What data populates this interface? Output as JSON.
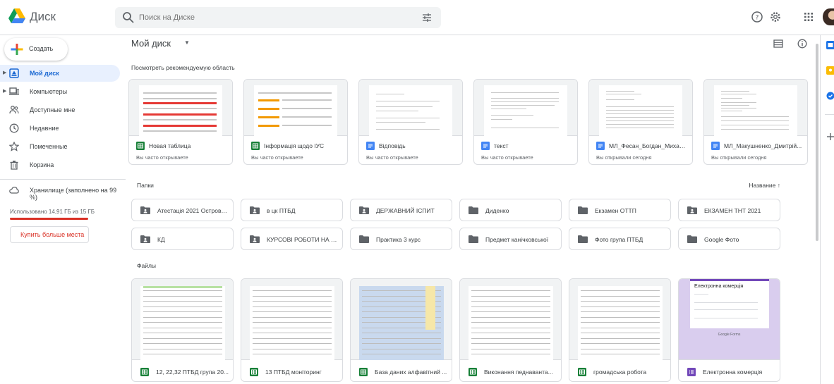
{
  "app": {
    "title": "Диск"
  },
  "search": {
    "placeholder": "Поиск на Диске"
  },
  "sidebar": {
    "create_label": "Создать",
    "items": [
      {
        "label": "Мой диск",
        "icon": "my-drive-icon",
        "active": true,
        "expandable": true
      },
      {
        "label": "Компьютеры",
        "icon": "computer-icon",
        "active": false,
        "expandable": true
      },
      {
        "label": "Доступные мне",
        "icon": "shared-people-icon",
        "active": false,
        "expandable": false
      },
      {
        "label": "Недавние",
        "icon": "clock-icon",
        "active": false,
        "expandable": false
      },
      {
        "label": "Помеченные",
        "icon": "star-icon",
        "active": false,
        "expandable": false
      },
      {
        "label": "Корзина",
        "icon": "trash-icon",
        "active": false,
        "expandable": false
      }
    ],
    "storage_label": "Хранилище (заполнено на 99 %)",
    "storage_used": "Использовано 14,91 ГБ из 15 ГБ",
    "storage_fraction": 0.99,
    "buy_label": "Купить больше места"
  },
  "main": {
    "breadcrumb": "Мой диск",
    "suggested_title": "Посмотреть рекомендуемую область",
    "quick_access": [
      {
        "name": "Новая таблица",
        "sub": "Вы часто открываете",
        "type": "sheet"
      },
      {
        "name": "Інформація щодо ІУС",
        "sub": "Вы часто открываете",
        "type": "sheet"
      },
      {
        "name": "Відповідь",
        "sub": "Вы часто открываете",
        "type": "doc"
      },
      {
        "name": "текст",
        "sub": "Вы часто открываете",
        "type": "doc"
      },
      {
        "name": "МЛ_Фесан_Богдан_Михайл...",
        "sub": "Вы открывали сегодня",
        "type": "doc"
      },
      {
        "name": "МЛ_Макушненко_Дмитрій...",
        "sub": "Вы открывали сегодня",
        "type": "doc"
      }
    ],
    "folders_title": "Папки",
    "sort_label": "Название",
    "folders": [
      {
        "name": "Атестація 2021 Острове...",
        "shared": true
      },
      {
        "name": "в цк ПТБД",
        "shared": true
      },
      {
        "name": "ДЕРЖАВНИЙ ІСПИТ",
        "shared": true
      },
      {
        "name": "Диденко",
        "shared": false
      },
      {
        "name": "Екзамен ОТТП",
        "shared": false
      },
      {
        "name": "ЕКЗАМЕН ТНТ 2021",
        "shared": true
      },
      {
        "name": "КД",
        "shared": true
      },
      {
        "name": "КУРСОВІ РОБОТИ НА М...",
        "shared": true
      },
      {
        "name": "Практика 3 курс",
        "shared": false
      },
      {
        "name": "Предмет канічковської",
        "shared": false
      },
      {
        "name": "Фото група ПТБД",
        "shared": false
      },
      {
        "name": "Google Фото",
        "shared": false
      }
    ],
    "files_title": "Файлы",
    "files": [
      {
        "name": "12, 22,32 ПТБД група 20...",
        "type": "sheet"
      },
      {
        "name": "13 ПТБД моніторинг",
        "type": "sheet"
      },
      {
        "name": "База даних алфавітний ...",
        "type": "sheet"
      },
      {
        "name": "Виконання педнаванта...",
        "type": "sheet"
      },
      {
        "name": "громадська робота",
        "type": "sheet"
      },
      {
        "name": "Електронна комерція",
        "type": "form"
      }
    ],
    "form_preview": {
      "title": "Електронна комерція",
      "footer": "Google Forms"
    }
  },
  "colors": {
    "sheet": "#188038",
    "doc": "#4285f4",
    "form": "#7248b9",
    "folder": "#5f6368",
    "active_bg": "#e8f0fe",
    "active_text": "#1967d2",
    "storage_bar": "#d93025"
  }
}
